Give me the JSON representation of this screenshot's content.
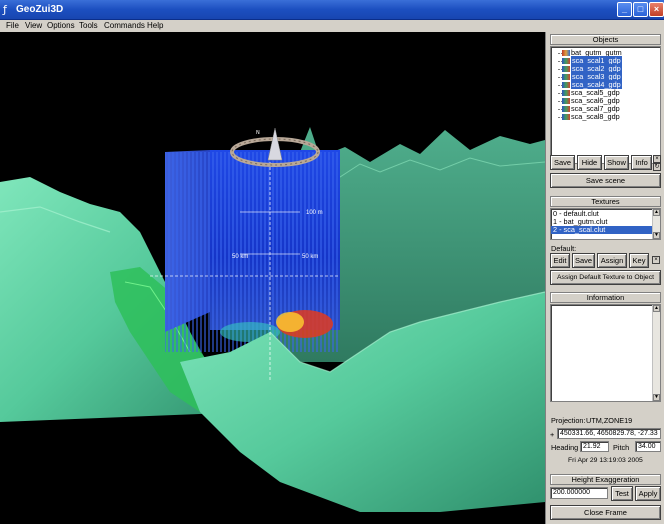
{
  "window": {
    "title": "GeoZui3D",
    "controls": [
      "_",
      "□",
      "×"
    ]
  },
  "menu": [
    "File",
    "View",
    "Options",
    "Tools",
    "Commands",
    "Help"
  ],
  "scene": {
    "labels": {
      "top": "100 m",
      "left": "50 km",
      "right": "50 km"
    }
  },
  "objects": {
    "header": "Objects",
    "items": [
      {
        "label": "bat_gutm_gutm",
        "selected": false,
        "icon": "grid-icon"
      },
      {
        "label": "sca_scal1_gdp",
        "selected": true,
        "icon": "surface-icon"
      },
      {
        "label": "sca_scal2_gdp",
        "selected": true,
        "icon": "surface-icon"
      },
      {
        "label": "sca_scal3_gdp",
        "selected": true,
        "icon": "surface-icon"
      },
      {
        "label": "sca_scal4_gdp",
        "selected": true,
        "icon": "surface-icon"
      },
      {
        "label": "sca_scal5_gdp",
        "selected": false,
        "icon": "surface-icon"
      },
      {
        "label": "sca_scal6_gdp",
        "selected": false,
        "icon": "surface-icon"
      },
      {
        "label": "sca_scal7_gdp",
        "selected": false,
        "icon": "surface-icon"
      },
      {
        "label": "sca_scal8_gdp",
        "selected": false,
        "icon": "surface-icon"
      }
    ],
    "buttons": {
      "save": "Save",
      "hide": "Hide",
      "show": "Show",
      "info": "Info",
      "save_scene": "Save scene"
    }
  },
  "textures": {
    "header": "Textures",
    "items": [
      {
        "label": "0 - default.clut",
        "selected": false
      },
      {
        "label": "1 - bat_gutm.clut",
        "selected": false
      },
      {
        "label": "2 - sca_scal.clut",
        "selected": true
      }
    ],
    "default_label": "Default:",
    "buttons": {
      "edit": "Edit",
      "save": "Save",
      "assign": "Assign",
      "key": "Key",
      "assign_default": "Assign Default Texture to Object"
    }
  },
  "information": {
    "header": "Information",
    "projection_label": "Projection:",
    "projection_value": "UTM,ZONE19",
    "coords_marker": "+",
    "coords": "450331.66, 4650829.78, -27.33",
    "heading_label": "Heading",
    "heading": "21.92",
    "pitch_label": "Pitch",
    "pitch": "34.00",
    "timestamp": "Fri Apr 29 13:19:03 2005"
  },
  "height_exaggeration": {
    "header": "Height Exaggeration",
    "value": "200.000000",
    "test": "Test",
    "apply": "Apply"
  },
  "close_frame": "Close Frame",
  "colors": {
    "titlebar": "#1c4fc0",
    "selection": "#3163c5",
    "terrain": "#5fd3a4",
    "cube": "#1a3fd8"
  }
}
